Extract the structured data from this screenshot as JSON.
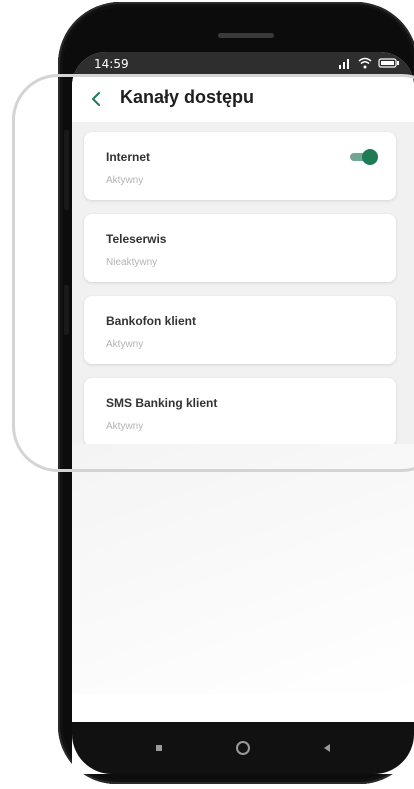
{
  "status_bar": {
    "time": "14:59",
    "icons": [
      "signal-icon",
      "wifi-icon",
      "battery-icon"
    ]
  },
  "header": {
    "back_icon": "chevron-left-icon",
    "title": "Kanały dostępu"
  },
  "channels": [
    {
      "name": "Internet",
      "status": "Aktywny",
      "toggle_visible": true,
      "toggle_on": true
    },
    {
      "name": "Teleserwis",
      "status": "Nieaktywny",
      "toggle_visible": false
    },
    {
      "name": "Bankofon klient",
      "status": "Aktywny",
      "toggle_visible": false
    },
    {
      "name": "SMS Banking klient",
      "status": "Aktywny",
      "toggle_visible": false
    }
  ],
  "colors": {
    "accent": "#1f7a56",
    "toggle_track": "#6fa694",
    "status_text": "#b3b3b3",
    "title_text": "#1f1f1f"
  },
  "nav_bar": {
    "buttons": [
      "recent-apps-icon",
      "home-icon",
      "back-nav-icon"
    ]
  }
}
